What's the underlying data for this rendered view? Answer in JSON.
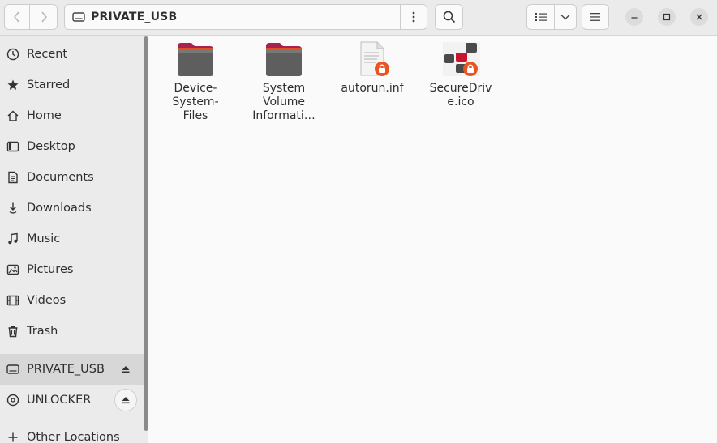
{
  "header": {
    "location": "PRIVATE_USB"
  },
  "sidebar": {
    "places": [
      {
        "label": "Recent",
        "icon": "clock-icon"
      },
      {
        "label": "Starred",
        "icon": "star-icon"
      },
      {
        "label": "Home",
        "icon": "home-icon"
      },
      {
        "label": "Desktop",
        "icon": "desktop-icon"
      },
      {
        "label": "Documents",
        "icon": "document-icon"
      },
      {
        "label": "Downloads",
        "icon": "download-icon"
      },
      {
        "label": "Music",
        "icon": "music-icon"
      },
      {
        "label": "Pictures",
        "icon": "picture-icon"
      },
      {
        "label": "Videos",
        "icon": "video-icon"
      },
      {
        "label": "Trash",
        "icon": "trash-icon"
      }
    ],
    "devices": [
      {
        "label": "PRIVATE_USB",
        "icon": "drive-icon",
        "selected": true
      },
      {
        "label": "UNLOCKER",
        "icon": "disc-icon",
        "selected": false
      }
    ],
    "other": {
      "label": "Other Locations",
      "icon": "plus-icon"
    }
  },
  "files": [
    {
      "name": "Device-System-Files",
      "display": "Device-\nSystem-\nFiles",
      "type": "folder"
    },
    {
      "name": "System Volume Information",
      "display": "System\nVolume\nInformati…",
      "type": "folder"
    },
    {
      "name": "autorun.inf",
      "display": "autorun.inf",
      "type": "text-locked"
    },
    {
      "name": "SecureDrive.ico",
      "display": "SecureDriv\ne.ico",
      "type": "image-locked"
    }
  ],
  "colors": {
    "folder_tab": "#a8224e",
    "folder_body": "#5e5e5e",
    "lock_badge": "#e95420",
    "ico_red": "#c7162b"
  }
}
